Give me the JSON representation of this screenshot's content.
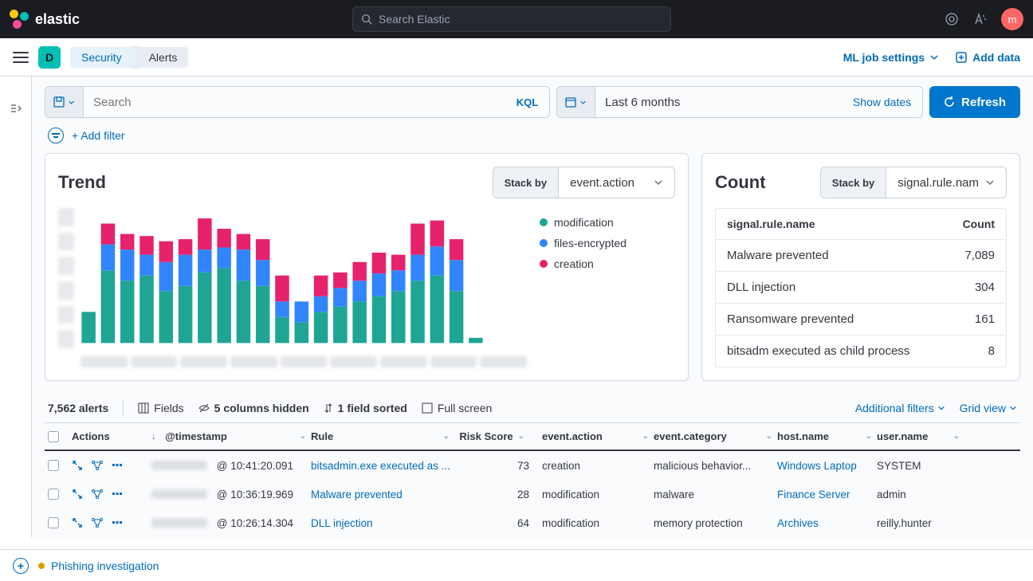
{
  "brand": "elastic",
  "global_search_placeholder": "Search Elastic",
  "avatar_letter": "m",
  "space_letter": "D",
  "breadcrumb": {
    "app": "Security",
    "page": "Alerts"
  },
  "header_actions": {
    "ml": "ML job settings",
    "add_data": "Add data"
  },
  "querybar": {
    "search_placeholder": "Search",
    "kql": "KQL",
    "date_range": "Last 6 months",
    "show_dates": "Show dates",
    "refresh": "Refresh"
  },
  "add_filter": "+ Add filter",
  "trend": {
    "title": "Trend",
    "stack_by_label": "Stack by",
    "stack_by_value": "event.action",
    "legend": [
      {
        "label": "modification",
        "color": "#1ea593"
      },
      {
        "label": "files-encrypted",
        "color": "#3185fc"
      },
      {
        "label": "creation",
        "color": "#e6226d"
      }
    ]
  },
  "count": {
    "title": "Count",
    "stack_by_label": "Stack by",
    "stack_by_value": "signal.rule.nam",
    "header_name": "signal.rule.name",
    "header_count": "Count",
    "rows": [
      {
        "name": "Malware prevented",
        "count": "7,089"
      },
      {
        "name": "DLL injection",
        "count": "304"
      },
      {
        "name": "Ransomware prevented",
        "count": "161"
      },
      {
        "name": "bitsadm executed as child process",
        "count": "8"
      }
    ]
  },
  "table": {
    "alerts_count": "7,562 alerts",
    "fields": "Fields",
    "hidden": "5 columns hidden",
    "sorted": "1 field sorted",
    "fullscreen": "Full screen",
    "additional_filters": "Additional filters",
    "grid_view": "Grid view",
    "columns": {
      "actions": "Actions",
      "timestamp": "@timestamp",
      "rule": "Rule",
      "risk": "Risk Score",
      "event_action": "event.action",
      "event_category": "event.category",
      "host": "host.name",
      "user": "user.name"
    },
    "rows": [
      {
        "time": "@ 10:41:20.091",
        "rule": "bitsadmin.exe executed as ...",
        "risk": "73",
        "action": "creation",
        "category": "malicious behavior...",
        "host": "Windows Laptop",
        "user": "SYSTEM"
      },
      {
        "time": "@ 10:36:19.969",
        "rule": "Malware prevented",
        "risk": "28",
        "action": "modification",
        "category": "malware",
        "host": "Finance Server",
        "user": "admin"
      },
      {
        "time": "@ 10:26:14.304",
        "rule": "DLL injection",
        "risk": "64",
        "action": "modification",
        "category": "memory protection",
        "host": "Archives",
        "user": "reilly.hunter"
      }
    ]
  },
  "footer": {
    "investigation": "Phishing investigation"
  },
  "chart_data": {
    "type": "bar",
    "stacked": true,
    "series": [
      {
        "name": "modification",
        "color": "#1ea593",
        "values": [
          30,
          70,
          60,
          65,
          50,
          55,
          68,
          72,
          60,
          55,
          25,
          20,
          30,
          35,
          40,
          45,
          50,
          60,
          65,
          50,
          5,
          0,
          0
        ]
      },
      {
        "name": "files-encrypted",
        "color": "#3185fc",
        "values": [
          0,
          25,
          30,
          20,
          28,
          30,
          22,
          20,
          30,
          25,
          15,
          20,
          15,
          18,
          20,
          22,
          20,
          25,
          28,
          30,
          0,
          0,
          0
        ]
      },
      {
        "name": "creation",
        "color": "#e6226d",
        "values": [
          0,
          20,
          15,
          18,
          20,
          15,
          30,
          18,
          15,
          20,
          25,
          0,
          20,
          15,
          18,
          20,
          15,
          30,
          25,
          20,
          0,
          0,
          0
        ]
      }
    ],
    "categories_count": 23,
    "ylim": [
      0,
      130
    ]
  }
}
